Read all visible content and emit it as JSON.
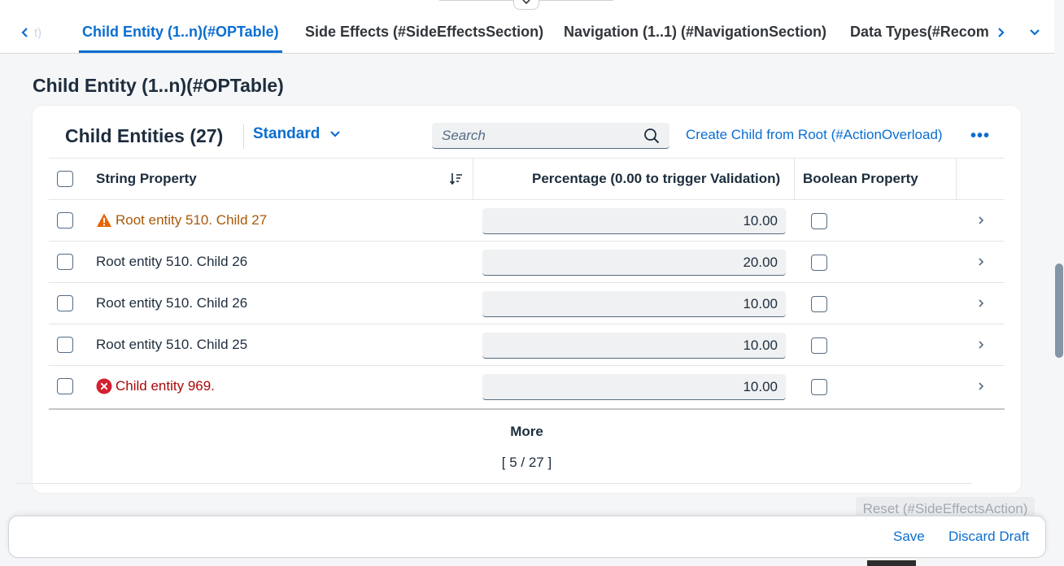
{
  "anchor_bar": {
    "prev_tab_fragment": "t)",
    "tabs": [
      {
        "label": "Child Entity (1..n)(#OPTable)",
        "active": true
      },
      {
        "label": "Side Effects (#SideEffectsSection)",
        "active": false
      },
      {
        "label": "Navigation (1..1) (#NavigationSection)",
        "active": false
      },
      {
        "label": "Data Types(#Recommendations)",
        "active": false
      }
    ]
  },
  "section": {
    "title": "Child Entity (1..n)(#OPTable)"
  },
  "table": {
    "title": "Child Entities (27)",
    "variant": "Standard",
    "search_placeholder": "Search",
    "create_action": "Create Child from Root (#ActionOverload)",
    "more_actions": "•••",
    "columns": {
      "string_property": "String Property",
      "percentage": "Percentage (0.00 to trigger Validation)",
      "boolean_property": "Boolean Property"
    },
    "rows": [
      {
        "name": "Root entity 510. Child 27",
        "status": "warning",
        "percentage": "10.00",
        "boolean": false
      },
      {
        "name": "Root entity 510. Child 26",
        "status": "none",
        "percentage": "20.00",
        "boolean": false
      },
      {
        "name": "Root entity 510. Child 26",
        "status": "none",
        "percentage": "10.00",
        "boolean": false
      },
      {
        "name": "Root entity 510. Child 25",
        "status": "none",
        "percentage": "10.00",
        "boolean": false
      },
      {
        "name": "Child entity 969.",
        "status": "error",
        "percentage": "10.00",
        "boolean": false
      }
    ],
    "more_label": "More",
    "more_count": "[ 5 / 27 ]"
  },
  "reset_action": "Reset (#SideEffectsAction)",
  "footer": {
    "save": "Save",
    "discard": "Discard Draft"
  },
  "colors": {
    "accent": "#0a6ed1",
    "warning": "#aa5808",
    "error": "#aa0808"
  }
}
